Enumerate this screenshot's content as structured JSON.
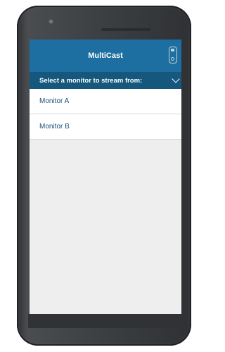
{
  "app": {
    "title": "MultiCast",
    "header_icon": "phone-device-icon"
  },
  "selector": {
    "label": "Select a monitor to stream from:",
    "icon": "chevron-down-icon"
  },
  "monitors": [
    {
      "label": "Monitor A"
    },
    {
      "label": "Monitor B"
    }
  ],
  "colors": {
    "header": "#1c6fa0",
    "selector_bar": "#15577d",
    "item_text": "#1a4f7a",
    "screen_bg": "#eeeeee"
  }
}
